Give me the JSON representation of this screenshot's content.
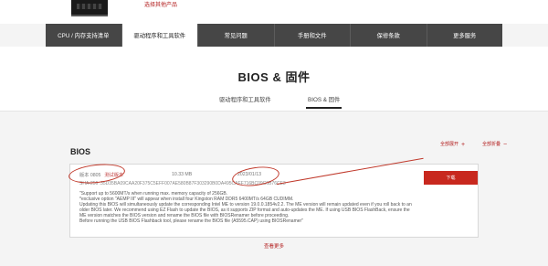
{
  "top": {
    "link_text": "选择其他产品"
  },
  "tabs": [
    {
      "label": "CPU / 内存支持清单"
    },
    {
      "label": "驱动程序和工具软件"
    },
    {
      "label": "常见问题"
    },
    {
      "label": "手册和文件"
    },
    {
      "label": "保修条款"
    },
    {
      "label": "更多服务"
    }
  ],
  "page": {
    "title": "BIOS & 固件"
  },
  "subtabs": [
    {
      "label": "驱动程序和工具软件"
    },
    {
      "label": "BIOS & 固件"
    }
  ],
  "section": {
    "heading": "BIOS",
    "expand_all": "全部展开",
    "collapse_all": "全部折叠",
    "expand_symbol": "+",
    "collapse_symbol": "−"
  },
  "bios_entry": {
    "version": "版本 0805",
    "beta": "测试版本",
    "size": "10.33 MB",
    "date": "2023/01/13",
    "sha": "SHA-256 :35D35BA09CAA20F375C5EFF007AE580B87F303290B0DA495CAEF716BC09C6B76CE3",
    "desc_lines": [
      "\"Support up to 5600MT/s when running max. memory capacity of 256GB.",
      "*exclusive option \"AEMP III\" will appear when install four Kingston RAM DDR5 6400MT/s 64GB CUDIMM.",
      "Updating this BIOS will simultaneously update the corresponding Intel ME to version 19.0.0.1854v2.2. The ME version will remain updated even if you roll back to an older BIOS later. We recommend using EZ Flash to update the BIOS, as it supports ZIP format and auto-updates the ME. If using USB BIOS FlashBack, ensure the ME version matches the BIOS version and rename the BIOS file with BIOSRenamer before proceeding.",
      "Before running the USB BIOS Flashback tool, please rename the BIOS file (A5595.CAP) using BIOSRenamer\""
    ],
    "download_label": "下载"
  },
  "view_more": "查看更多",
  "colors": {
    "accent_red": "#c8281e",
    "tabbar_bg": "#464646",
    "annotation_red": "#c0392b"
  }
}
